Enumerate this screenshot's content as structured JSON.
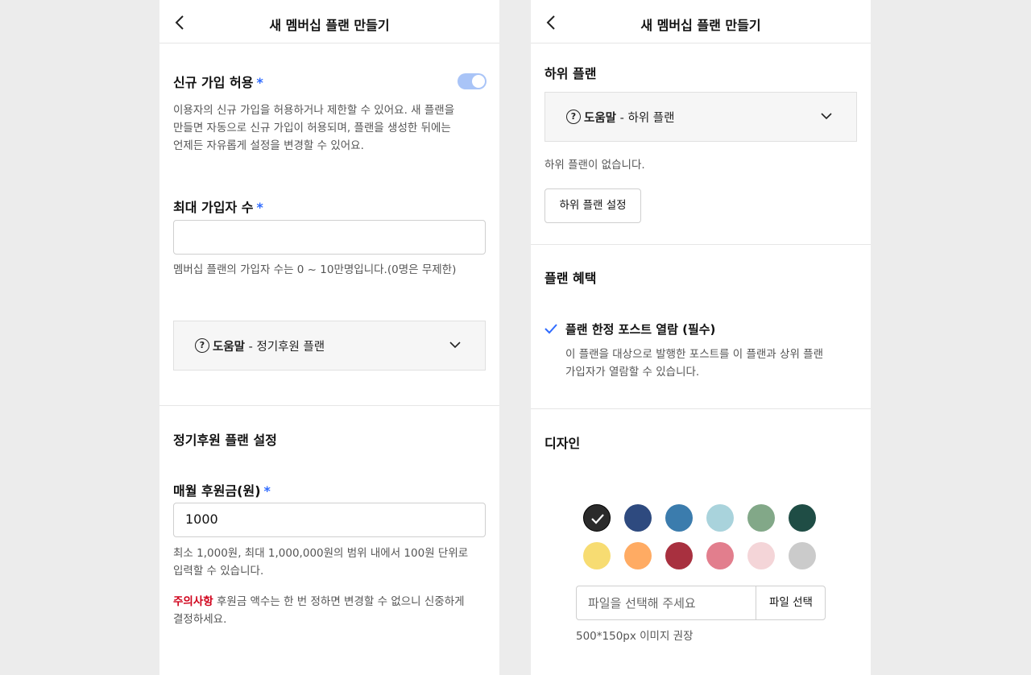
{
  "left_panel": {
    "title": "새 멤버십 플랜 만들기",
    "signup_allow": {
      "label": "신규 가입 허용",
      "required": "*",
      "description_lines": [
        "이용자의 신규 가입을 허용하거나 제한할 수 있어요. 새 플랜을",
        "만들면 자동으로 신규 가입이 허용되며, 플랜을 생성한 뒤에는",
        "언제든 자유롭게 설정을 변경할 수 있어요."
      ],
      "toggle_on": true
    },
    "max_members": {
      "label": "최대 가입자 수",
      "required": "*",
      "value": "",
      "helper": "멤버십 플랜의 가입자 수는 0 ~ 10만명입니다.(0명은 무제한)"
    },
    "help": {
      "icon_char": "?",
      "bold": "도움말",
      "rest": " - 정기후원 플랜"
    },
    "section_title": "정기후원 플랜 설정",
    "monthly": {
      "label": "매월 후원금(원)",
      "required": "*",
      "value": "1000",
      "helper_lines": [
        "최소 1,000원, 최대 1,000,000원의 범위 내에서 100원 단위로",
        "입력할 수 있습니다."
      ],
      "warning_label": "주의사항",
      "warning_line1": " 후원금 액수는 한 번 정하면 변경할 수 없으니 신중하게",
      "warning_line2": "결정하세요."
    }
  },
  "right_panel": {
    "title": "새 멤버십 플랜 만들기",
    "sub_plan": {
      "label": "하위 플랜",
      "help_icon_char": "?",
      "help_bold": "도움말",
      "help_rest": " - 하위 플랜",
      "empty_text": "하위 플랜이 없습니다.",
      "button_label": "하위 플랜 설정"
    },
    "benefits": {
      "label": "플랜 혜택",
      "item_title": "플랜 한정 포스트 열람 (필수)",
      "item_desc_lines": [
        "이 플랜을 대상으로 발행한 포스트를 이 플랜과 상위 플랜",
        "가입자가 열람할 수 있습니다."
      ]
    },
    "design": {
      "label": "디자인",
      "colors": [
        {
          "name": "black",
          "hex": "#2b2b2b",
          "selected": true
        },
        {
          "name": "navy",
          "hex": "#2e4a7f",
          "selected": false
        },
        {
          "name": "blue",
          "hex": "#3b7cad",
          "selected": false
        },
        {
          "name": "light-blue",
          "hex": "#a9d3dc",
          "selected": false
        },
        {
          "name": "sage",
          "hex": "#82a888",
          "selected": false
        },
        {
          "name": "dark-green",
          "hex": "#1f4d45",
          "selected": false
        },
        {
          "name": "yellow",
          "hex": "#f7dc72",
          "selected": false
        },
        {
          "name": "orange",
          "hex": "#ffab63",
          "selected": false
        },
        {
          "name": "crimson",
          "hex": "#a8303f",
          "selected": false
        },
        {
          "name": "pink",
          "hex": "#e27e8d",
          "selected": false
        },
        {
          "name": "light-pink",
          "hex": "#f4d5d8",
          "selected": false
        },
        {
          "name": "gray",
          "hex": "#cbcbcb",
          "selected": false
        }
      ],
      "file_placeholder": "파일을 선택해 주세요",
      "file_button": "파일 선택",
      "file_hint": "500*150px 이미지 권장"
    }
  },
  "colors": {
    "accent_blue": "#2f6bff",
    "warning_red": "#d0021b",
    "toggle_on": "#a9c4f7"
  }
}
